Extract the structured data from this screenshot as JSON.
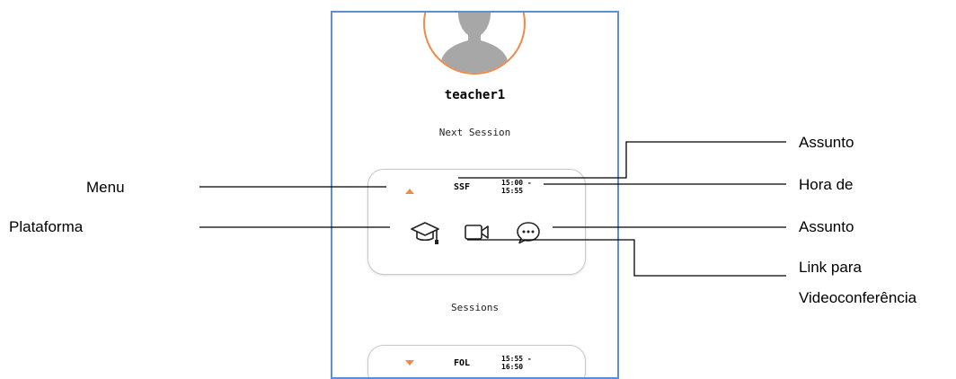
{
  "user": {
    "name": "teacher1"
  },
  "next_session": {
    "heading": "Next Session",
    "card": {
      "subject": "SSF",
      "time": "15:00 -\n15:55",
      "icons": [
        "platform-graduation-cap-icon",
        "video-camera-icon",
        "chat-bubble-icon"
      ]
    }
  },
  "sessions": {
    "heading": "Sessions",
    "items": [
      {
        "subject": "FOL",
        "time": "15:55 -\n16:50"
      }
    ]
  },
  "callouts": {
    "menu": "Menu",
    "platform": "Plataforma",
    "subject_top": "Assunto",
    "time": "Hora de",
    "subject_chat": "Assunto",
    "video_link_line1": "Link para",
    "video_link_line2": "Videoconferência"
  },
  "colors": {
    "accent": "#f08a4b",
    "frame": "#5b8fd6"
  }
}
